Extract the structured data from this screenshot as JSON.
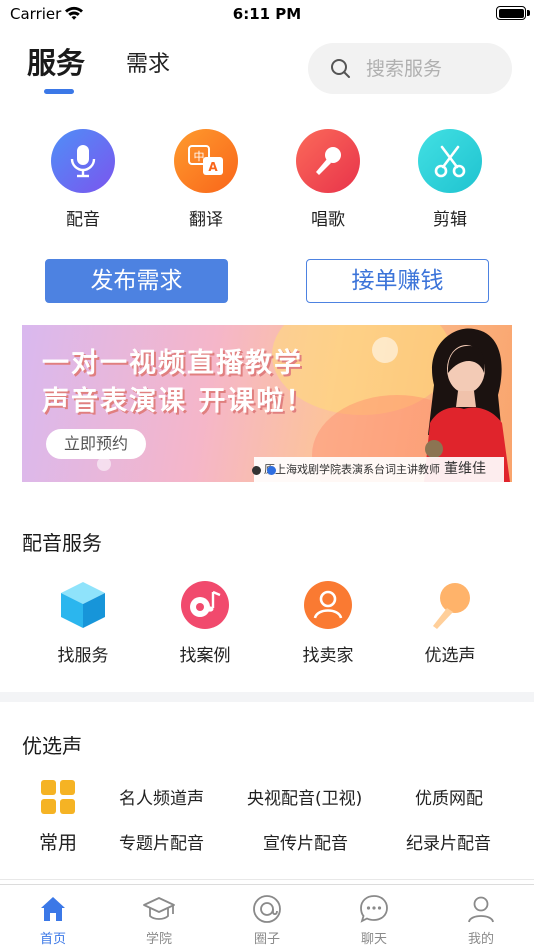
{
  "status_bar": {
    "carrier": "Carrier",
    "time": "6:11 PM"
  },
  "header": {
    "tabs": [
      {
        "label": "服务",
        "active": true
      },
      {
        "label": "需求",
        "active": false
      }
    ],
    "search_placeholder": "搜索服务",
    "accent_color": "#3b78e7"
  },
  "categories": [
    {
      "label": "配音",
      "icon": "microphone-icon",
      "color": "#6a6cf0"
    },
    {
      "label": "翻译",
      "icon": "translate-icon",
      "color": "#fb7d1f"
    },
    {
      "label": "唱歌",
      "icon": "karaoke-mic-icon",
      "color": "#f04b4b"
    },
    {
      "label": "剪辑",
      "icon": "scissors-icon",
      "color": "#3ad5d8"
    }
  ],
  "actions": {
    "publish_label": "发布需求",
    "take_order_label": "接单赚钱"
  },
  "banner": {
    "line1": "一对一视频直播教学",
    "line2": "声音表演课  开课啦！",
    "cta": "立即预约",
    "caption": "原上海戏剧学院表演系台词主讲教师",
    "teacher_name": "董维佳",
    "pages": 2,
    "active_page": 2
  },
  "dubbing_services": {
    "title": "配音服务",
    "items": [
      {
        "label": "找服务",
        "icon": "cube-icon"
      },
      {
        "label": "找案例",
        "icon": "music-disc-icon"
      },
      {
        "label": "找卖家",
        "icon": "person-icon"
      },
      {
        "label": "优选声",
        "icon": "microphone-icon"
      }
    ]
  },
  "preferred_voices": {
    "title": "优选声",
    "common_label": "常用",
    "row1": [
      "名人频道声",
      "央视配音(卫视)",
      "优质网配"
    ],
    "row2": [
      "专题片配音",
      "宣传片配音",
      "纪录片配音"
    ]
  },
  "tab_bar": {
    "items": [
      {
        "label": "首页",
        "icon": "home-icon",
        "active": true
      },
      {
        "label": "学院",
        "icon": "graduation-cap-icon",
        "active": false
      },
      {
        "label": "圈子",
        "icon": "at-circle-icon",
        "active": false
      },
      {
        "label": "聊天",
        "icon": "chat-bubble-icon",
        "active": false
      },
      {
        "label": "我的",
        "icon": "user-icon",
        "active": false
      }
    ]
  }
}
